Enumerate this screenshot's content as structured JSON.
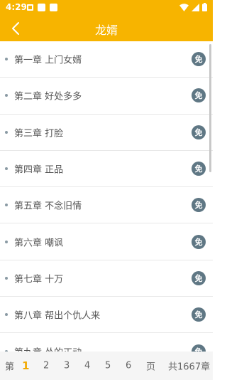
{
  "status": {
    "time": "4:29"
  },
  "header": {
    "title": "龙婿"
  },
  "chapters": [
    {
      "label": "第一章 上门女婿",
      "badge": "免"
    },
    {
      "label": "第二章 好处多多",
      "badge": "免"
    },
    {
      "label": "第三章 打脸",
      "badge": "免"
    },
    {
      "label": "第四章 正品",
      "badge": "免"
    },
    {
      "label": "第五章 不念旧情",
      "badge": "免"
    },
    {
      "label": "第六章 嘲讽",
      "badge": "免"
    },
    {
      "label": "第七章 十万",
      "badge": "免"
    },
    {
      "label": "第八章 帮出个仇人来",
      "badge": "免"
    },
    {
      "label": "第九章 怂的正动",
      "badge": "免"
    }
  ],
  "pager": {
    "prefix": "第",
    "pages": [
      "1",
      "2",
      "3",
      "4",
      "5",
      "6"
    ],
    "current": "1",
    "suffix": "页",
    "total": "共1667章"
  },
  "colors": {
    "accent": "#f7b400",
    "badge": "#5f7784",
    "active_page": "#f2a900"
  }
}
